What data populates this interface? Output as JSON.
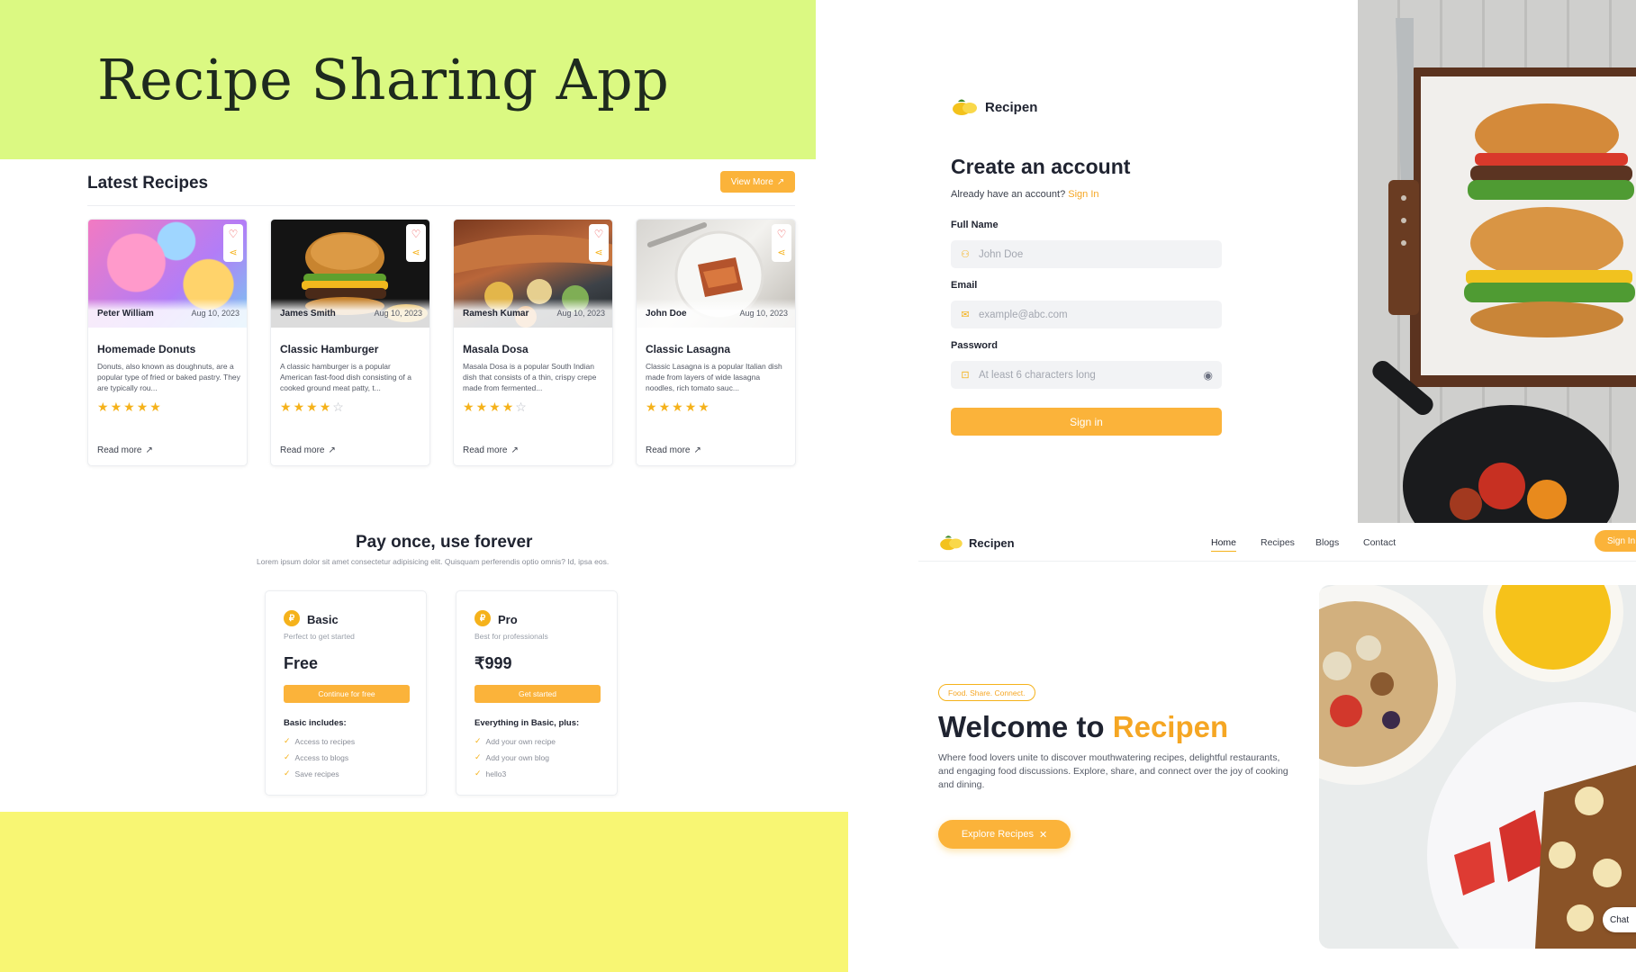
{
  "banner": {
    "title": "Recipe Sharing App"
  },
  "recipes": {
    "heading": "Latest Recipes",
    "view_more": "View More",
    "read_more": "Read more",
    "cards": [
      {
        "author": "Peter William",
        "date": "Aug 10, 2023",
        "title": "Homemade Donuts",
        "desc": "Donuts, also known as doughnuts, are a popular type of fried or baked pastry. They are typically rou...",
        "rating": 5
      },
      {
        "author": "James Smith",
        "date": "Aug 10, 2023",
        "title": "Classic Hamburger",
        "desc": "A classic hamburger is a popular American fast-food dish consisting of a cooked ground meat patty, t...",
        "rating": 4
      },
      {
        "author": "Ramesh Kumar",
        "date": "Aug 10, 2023",
        "title": "Masala Dosa",
        "desc": "Masala Dosa is a popular South Indian dish that consists of a thin, crispy crepe made from fermented...",
        "rating": 4
      },
      {
        "author": "John Doe",
        "date": "Aug 10, 2023",
        "title": "Classic Lasagna",
        "desc": "Classic Lasagna is a popular Italian dish made from layers of wide lasagna noodles, rich tomato sauc...",
        "rating": 5
      }
    ]
  },
  "pricing": {
    "title": "Pay once, use forever",
    "subtitle": "Lorem ipsum dolor sit amet consectetur adipisicing elit. Quisquam perferendis optio omnis? Id, ipsa eos.",
    "plans": [
      {
        "name": "Basic",
        "tagline": "Perfect to get started",
        "price": "Free",
        "cta": "Continue for free",
        "includes": "Basic includes:",
        "features": [
          "Access to recipes",
          "Access to blogs",
          "Save recipes"
        ]
      },
      {
        "name": "Pro",
        "tagline": "Best for professionals",
        "price": "₹999",
        "cta": "Get started",
        "includes": "Everything in Basic, plus:",
        "features": [
          "Add your own recipe",
          "Add your own blog",
          "hello3"
        ]
      }
    ]
  },
  "signup": {
    "brand": "Recipen",
    "title": "Create an account",
    "have_account": "Already have an account?",
    "sign_in_link": "Sign In",
    "full_name_label": "Full Name",
    "full_name_placeholder": "John Doe",
    "email_label": "Email",
    "email_placeholder": "example@abc.com",
    "password_label": "Password",
    "password_placeholder": "At least 6 characters long",
    "submit": "Sign in"
  },
  "landing": {
    "brand": "Recipen",
    "nav": [
      "Home",
      "Recipes",
      "Blogs",
      "Contact"
    ],
    "sign_in": "Sign In",
    "tagline": "Food. Share. Connect.",
    "welcome_prefix": "Welcome to",
    "welcome_accent": "Recipen",
    "description": "Where food lovers unite to discover mouthwatering recipes, delightful restaurants, and engaging food discussions. Explore, share, and connect over the joy of cooking and dining.",
    "explore": "Explore Recipes",
    "chat": "Chat"
  },
  "colors": {
    "accent": "#fbb33a",
    "banner": "#dbf982",
    "footer": "#f8f673"
  }
}
